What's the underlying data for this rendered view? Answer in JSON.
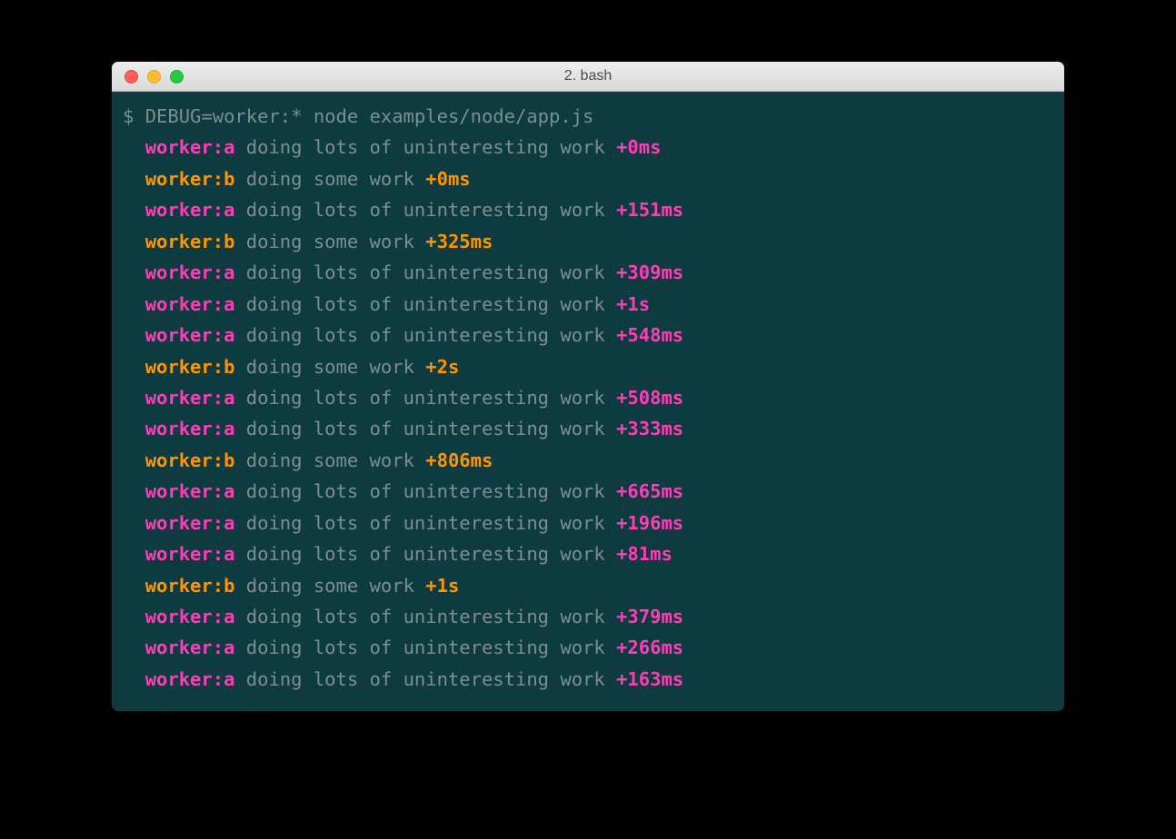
{
  "window": {
    "title": "2. bash"
  },
  "terminal": {
    "prompt": "$ ",
    "command": "DEBUG=worker:* node examples/node/app.js",
    "indent": "  ",
    "namespaces": {
      "a": "worker:a",
      "b": "worker:b"
    },
    "messages": {
      "a": " doing lots of uninteresting work ",
      "b": " doing some work "
    },
    "lines": [
      {
        "ns": "a",
        "time": "+0ms"
      },
      {
        "ns": "b",
        "time": "+0ms"
      },
      {
        "ns": "a",
        "time": "+151ms"
      },
      {
        "ns": "b",
        "time": "+325ms"
      },
      {
        "ns": "a",
        "time": "+309ms"
      },
      {
        "ns": "a",
        "time": "+1s"
      },
      {
        "ns": "a",
        "time": "+548ms"
      },
      {
        "ns": "b",
        "time": "+2s"
      },
      {
        "ns": "a",
        "time": "+508ms"
      },
      {
        "ns": "a",
        "time": "+333ms"
      },
      {
        "ns": "b",
        "time": "+806ms"
      },
      {
        "ns": "a",
        "time": "+665ms"
      },
      {
        "ns": "a",
        "time": "+196ms"
      },
      {
        "ns": "a",
        "time": "+81ms"
      },
      {
        "ns": "b",
        "time": "+1s"
      },
      {
        "ns": "a",
        "time": "+379ms"
      },
      {
        "ns": "a",
        "time": "+266ms"
      },
      {
        "ns": "a",
        "time": "+163ms"
      }
    ]
  }
}
